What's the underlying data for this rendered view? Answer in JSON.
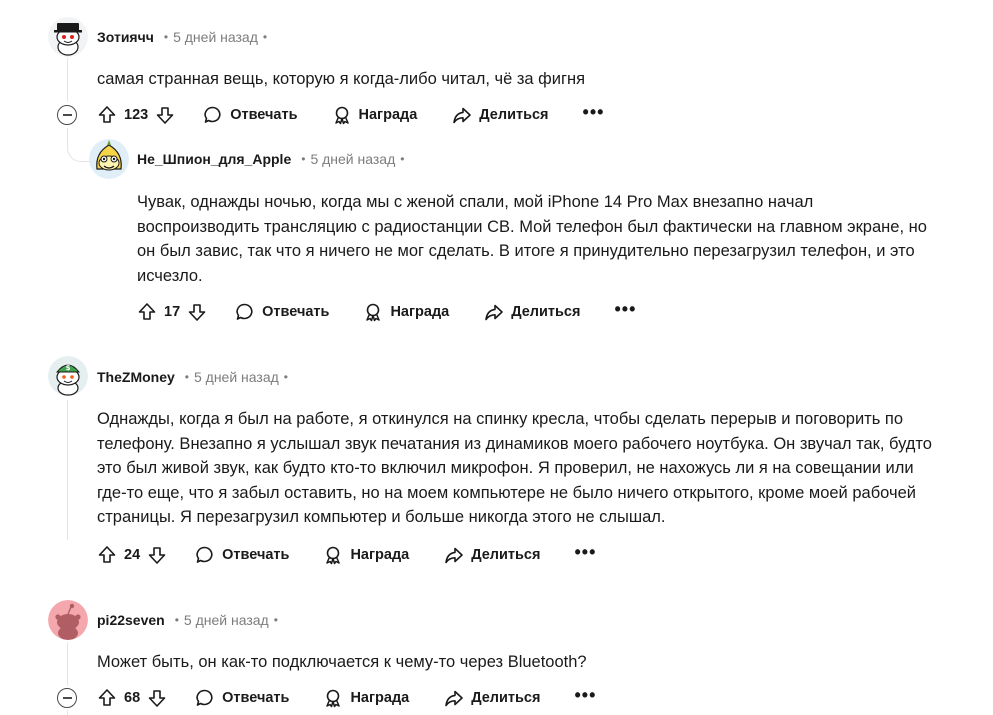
{
  "comments": [
    {
      "author": "Зотиячч",
      "time": "5 дней назад",
      "text": "самая странная вещь, которую я когда-либо читал, чё за фигня",
      "votes": "123",
      "actions": {
        "reply": "Отвечать",
        "award": "Награда",
        "share": "Делиться"
      }
    },
    {
      "author": "Не_Шпион_для_Apple",
      "time": "5 дней назад",
      "text_lines": [
        "Чувак, однажды ночью, когда мы с женой спали, мой iPhone 14 Pro Max внезапно начал",
        "воспроизводить трансляцию с радиостанции СВ. Мой телефон был фактически на главном экране, но",
        "он был завис, так что я ничего не мог сделать. В итоге я принудительно перезагрузил телефон, и это",
        "исчезло."
      ],
      "votes": "17",
      "actions": {
        "reply": "Отвечать",
        "award": "Награда",
        "share": "Делиться"
      }
    },
    {
      "author": "TheZMoney",
      "time": "5 дней назад",
      "text_lines": [
        "Однажды, когда я был на работе, я откинулся на спинку кресла, чтобы сделать перерыв и поговорить по",
        "телефону. Внезапно я услышал звук печатания из динамиков моего рабочего ноутбука. Он звучал так, будто",
        "это был живой звук, как будто кто-то включил микрофон. Я проверил, не нахожусь ли я на совещании или",
        "где-то еще, что я забыл оставить, но на моем компьютере не было ничего открытого, кроме моей рабочей",
        "страницы. Я перезагрузил компьютер и больше никогда этого не слышал."
      ],
      "votes": "24",
      "actions": {
        "reply": "Отвечать",
        "award": "Награда",
        "share": "Делиться"
      }
    },
    {
      "author": "pi22seven",
      "time": "5 дней назад",
      "text": "Может быть, он как-то подключается к чему-то через Bluetooth?",
      "votes": "68",
      "actions": {
        "reply": "Отвечать",
        "award": "Награда",
        "share": "Делиться"
      }
    }
  ],
  "more_label": "•••",
  "dot": "•",
  "colors": {
    "text": "#1a1a1b",
    "muted": "#7c7c7c",
    "thread": "#e5e5e5"
  }
}
